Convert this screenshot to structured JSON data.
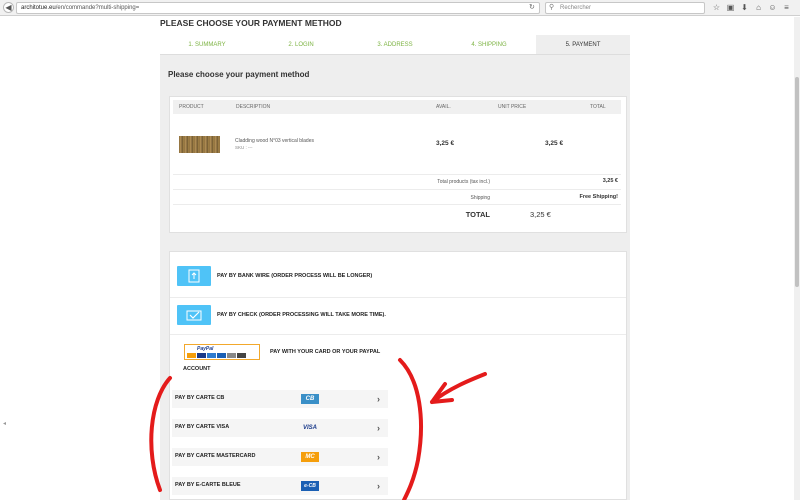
{
  "browser": {
    "url_host": "architotue.eu",
    "url_path": "/en/commande?multi-shipping=",
    "search_placeholder": "Rechercher",
    "reload_icon": "C"
  },
  "page": {
    "title": "PLEASE CHOOSE YOUR PAYMENT METHOD",
    "panel_title": "Please choose your payment method"
  },
  "steps": [
    {
      "label": "1. SUMMARY"
    },
    {
      "label": "2. LOGIN"
    },
    {
      "label": "3. ADDRESS"
    },
    {
      "label": "4. SHIPPING"
    },
    {
      "label": "5. PAYMENT"
    }
  ],
  "cart": {
    "headers": {
      "product": "PRODUCT",
      "description": "DESCRIPTION",
      "avail": "AVAIL.",
      "unit_price": "UNIT PRICE",
      "total": "TOTAL"
    },
    "item": {
      "description": "Cladding wood N°03 vertical blades",
      "sku": "SKU : ---",
      "avail_price": "3,25 €",
      "unit_price": "3,25 €"
    },
    "total_products_label": "Total products (tax incl.)",
    "total_products_value": "3,25 €",
    "shipping_label": "Shipping",
    "shipping_value": "Free Shipping!",
    "total_label": "TOTAL",
    "total_value": "3,25 €"
  },
  "payment": {
    "bank_wire": "PAY BY BANK WIRE (ORDER PROCESS WILL BE LONGER)",
    "check": "PAY BY CHECK (ORDER PROCESSING WILL TAKE MORE TIME).",
    "paypal_line1": "PAY WITH YOUR CARD OR YOUR PAYPAL",
    "paypal_line2": "ACCOUNT",
    "paypal_logo_text": "PayPal",
    "cards": [
      {
        "label": "PAY BY CARTE CB",
        "logo": "CB",
        "color": "#3a8fc7"
      },
      {
        "label": "PAY BY CARTE VISA",
        "logo": "VISA",
        "color": "#1a3a8a"
      },
      {
        "label": "PAY BY CARTE MASTERCARD",
        "logo": "MC",
        "color": "#f59e0b"
      },
      {
        "label": "PAY BY E-CARTE BLEUE",
        "logo": "e-CB",
        "color": "#1a5fb4"
      }
    ]
  },
  "colors": {
    "accent_green": "#7cb342",
    "payment_icon_blue": "#4fc3f7",
    "panel_grey": "#eeeeee"
  }
}
